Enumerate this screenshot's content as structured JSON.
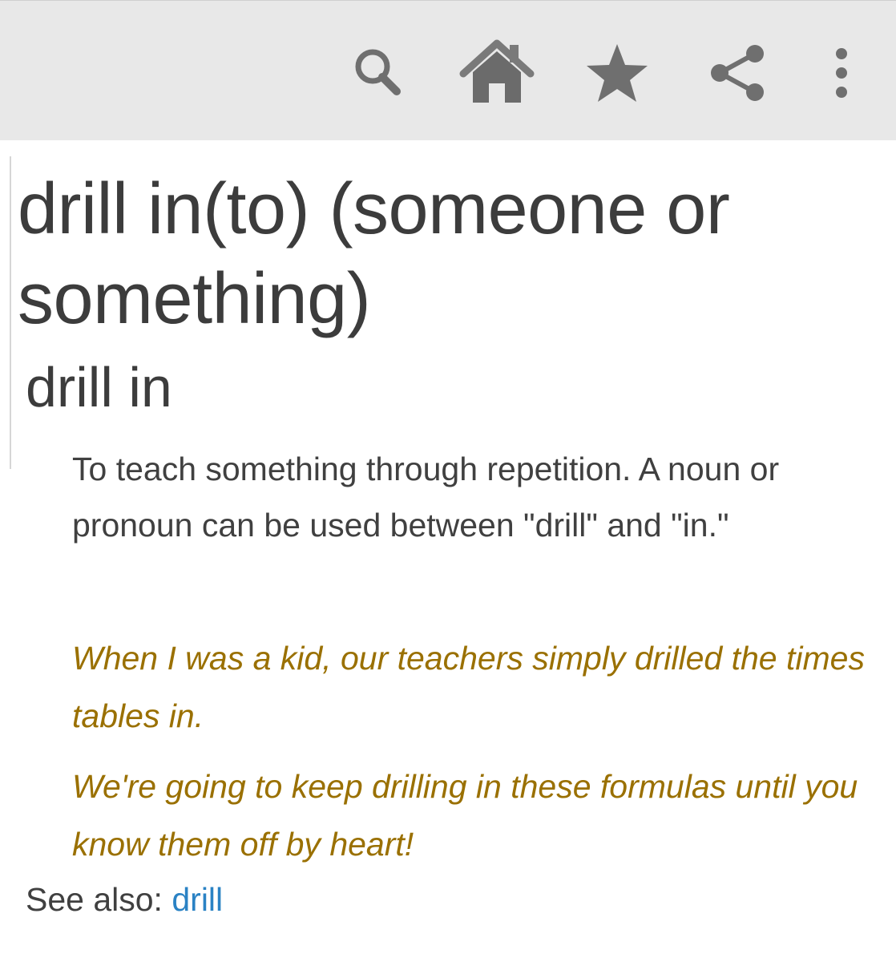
{
  "toolbar": {
    "icons": [
      "search-icon",
      "home-icon",
      "star-icon",
      "share-icon",
      "more-vertical-icon"
    ]
  },
  "entry": {
    "headword": "drill in(to) (someone or something)",
    "variant": "drill in",
    "definition": "To teach something through repetition. A noun or pronoun can be used between \"drill\" and \"in.\"",
    "examples": [
      "When I was a kid, our teachers simply drilled the times tables in.",
      "We're going to keep drilling in these formulas until you know them off by heart!"
    ],
    "see_also": {
      "label": "See also:",
      "link": "drill"
    }
  },
  "colors": {
    "toolbar_bg": "#e8e8e8",
    "icon": "#6f6f6f",
    "text": "#3c3c3c",
    "example": "#9a7000",
    "link": "#2a82c4"
  }
}
